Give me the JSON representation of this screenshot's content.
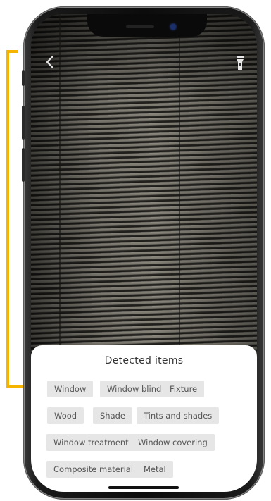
{
  "sheet": {
    "title": "Detected items",
    "chips": [
      "Window",
      "Window blind",
      "Fixture",
      "Wood",
      "Shade",
      "Tints and shades",
      "Window treatment",
      "Window covering",
      "Composite material",
      "Metal"
    ]
  },
  "icons": {
    "back": "chevron-left-icon",
    "flash": "flashlight-icon"
  },
  "colors": {
    "annotation": "#f4b400",
    "chip_bg": "#e6e6e6",
    "chip_text": "#555555"
  }
}
